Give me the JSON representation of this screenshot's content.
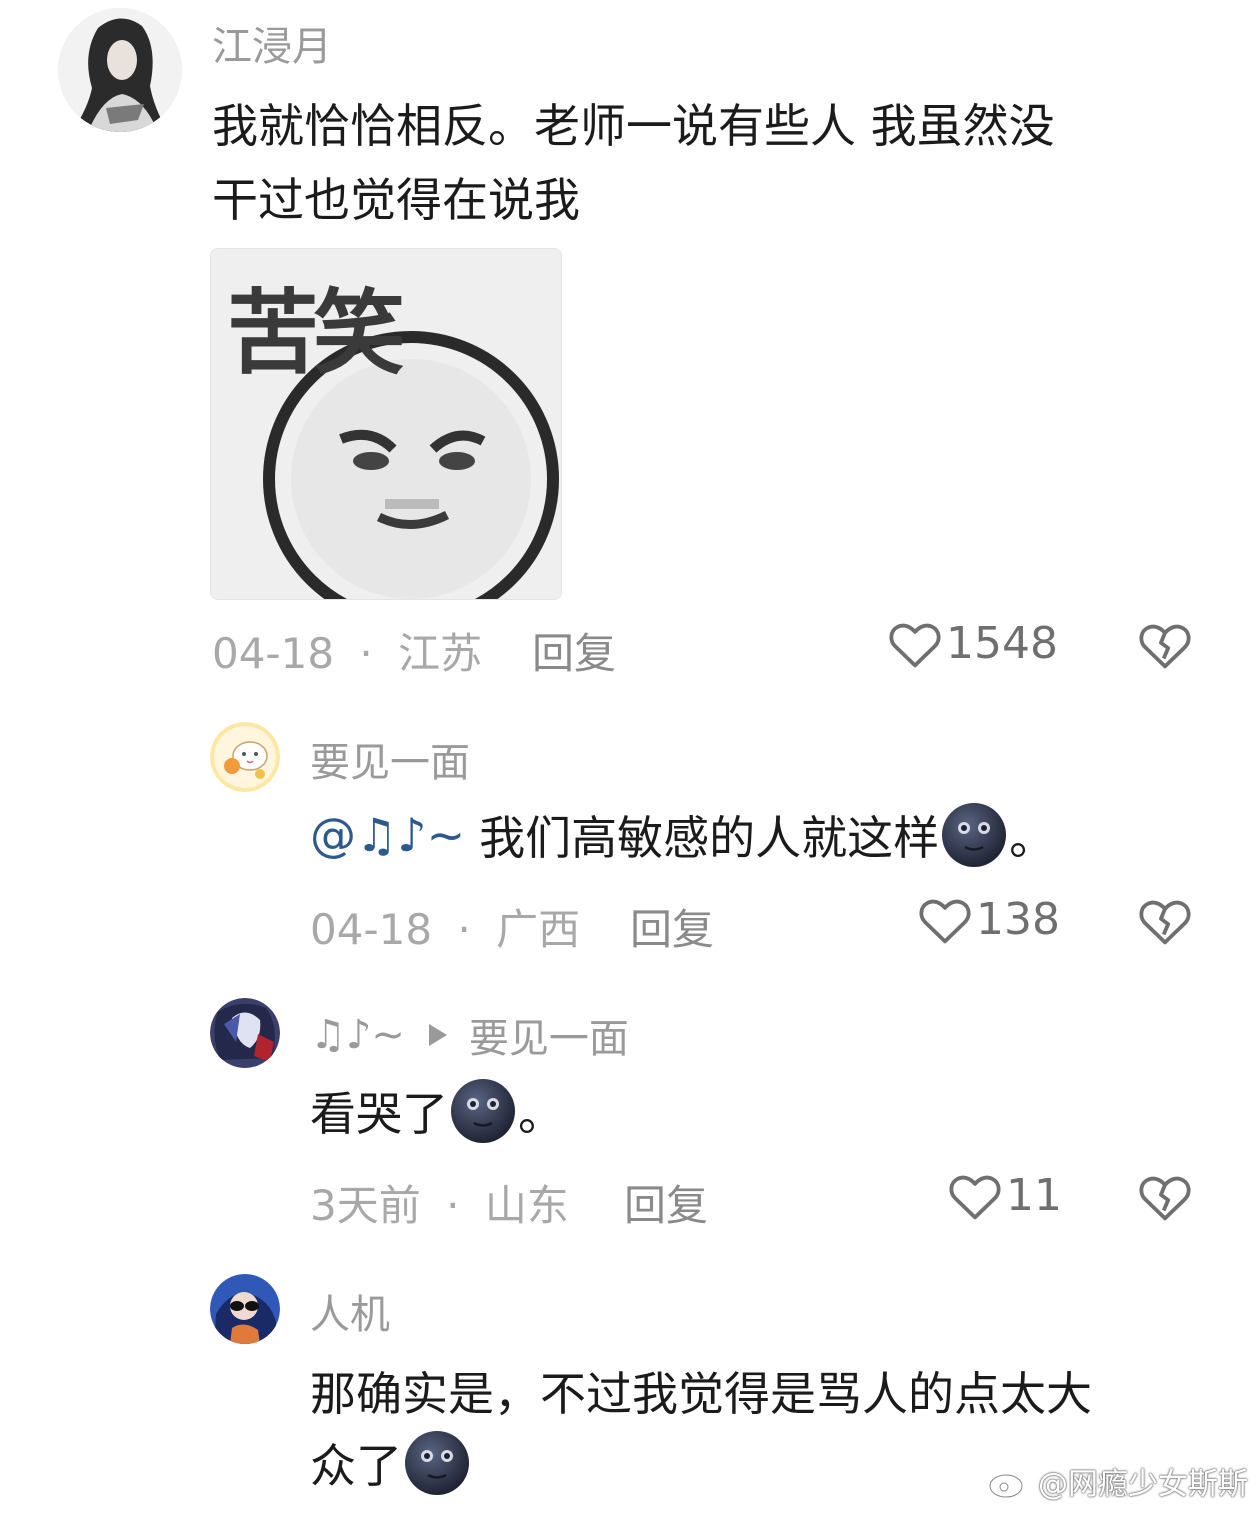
{
  "comments": [
    {
      "username": "江浸月",
      "text_line1": "我就恰恰相反。老师一说有些人 我虽然没",
      "text_line2": "干过也觉得在说我",
      "sticker_caption": "苦笑",
      "date": "04-18",
      "location": "江苏",
      "reply_label": "回复",
      "likes": "1548"
    },
    {
      "username": "要见一面",
      "mention": "@♫♪~",
      "text": "我们高敏感的人就这样",
      "text_end": "。",
      "date": "04-18",
      "location": "广西",
      "reply_label": "回复",
      "likes": "138"
    },
    {
      "username": "♫♪~",
      "reply_to": "要见一面",
      "text": "看哭了",
      "text_end": "。",
      "date": "3天前",
      "location": "山东",
      "reply_label": "回复",
      "likes": "11"
    },
    {
      "username": "人机",
      "text_line1": "那确实是，不过我觉得是骂人的点太大",
      "text_line2": "众了"
    }
  ],
  "meta_separator": "·",
  "icons": {
    "like": "heart-outline-icon",
    "dislike": "broken-heart-icon",
    "emoji": "new-moon-face-emoji",
    "reply_arrow": "play-triangle-icon",
    "watermark_logo": "weibo-logo-icon"
  },
  "colors": {
    "text": "#1b1b1b",
    "username": "#9a9a9a",
    "meta": "#a8a8a8",
    "mention": "#2c5a8e",
    "icon": "#6f6f6f"
  },
  "watermark": "@网瘾少女斯斯"
}
